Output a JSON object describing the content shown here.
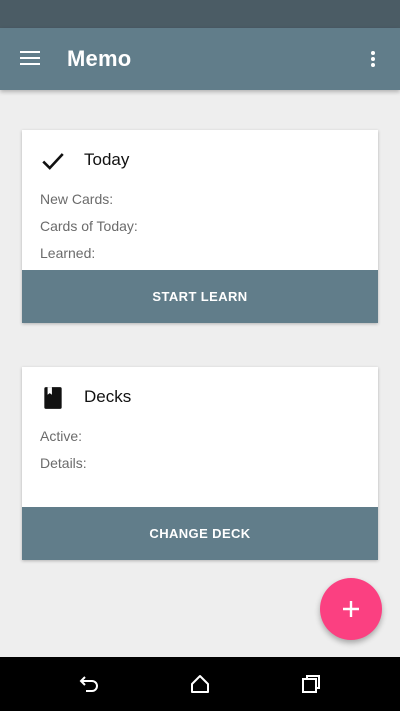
{
  "app_bar": {
    "title": "Memo",
    "menu_icon": "hamburger-menu-icon",
    "overflow_icon": "more-vert-icon"
  },
  "today_card": {
    "icon": "check-icon",
    "title": "Today",
    "rows": [
      "New Cards:",
      "Cards of Today:",
      "Learned:"
    ],
    "action_label": "START LEARN"
  },
  "decks_card": {
    "icon": "book-icon",
    "title": "Decks",
    "rows": [
      "Active:",
      "Details:"
    ],
    "action_label": "CHANGE DECK"
  },
  "fab": {
    "icon": "plus-icon"
  },
  "nav_bar": {
    "back_icon": "back-icon",
    "home_icon": "home-icon",
    "recents_icon": "recents-icon"
  },
  "colors": {
    "status_bar": "#4b5c65",
    "primary": "#617d8a",
    "accent": "#fb4081",
    "background": "#eeeeee"
  }
}
